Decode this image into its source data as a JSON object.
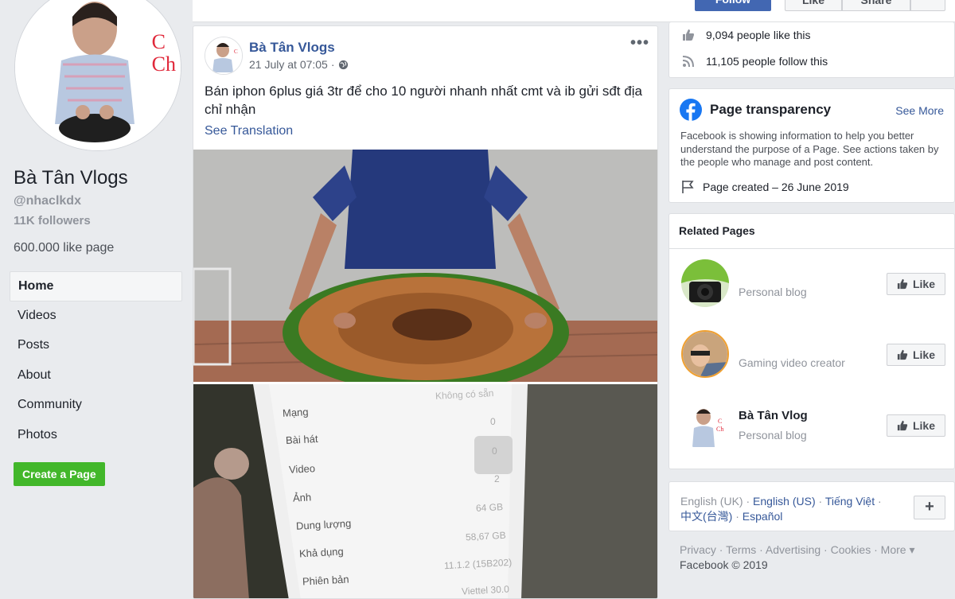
{
  "profile": {
    "name": "Bà Tân Vlogs",
    "handle": "@nhaclkdx",
    "followers": "11K followers",
    "like_page": "600.000 like page",
    "logo_text": "C\nCh"
  },
  "nav": {
    "items": [
      "Home",
      "Videos",
      "Posts",
      "About",
      "Community",
      "Photos"
    ],
    "create_page": "Create a Page"
  },
  "topbar": {
    "follow": "Follow",
    "like": "Like",
    "share": "Share"
  },
  "post": {
    "author": "Bà Tân Vlogs",
    "time": "21 July at 07:05",
    "separator": "·",
    "text": "Bán iphon 6plus giá 3tr để cho 10 người nhanh nhất cmt và ib gửi sđt địa chỉ nhận",
    "see_translation": "See Translation",
    "more": "•••",
    "phone_screen": {
      "status": "Không có sẵn",
      "rows": [
        {
          "label": "Mạng",
          "value": "0"
        },
        {
          "label": "Bài hát",
          "value": "0"
        },
        {
          "label": "Video",
          "value": "2"
        },
        {
          "label": "Ảnh",
          "value": "64 GB"
        },
        {
          "label": "Dung lượng",
          "value": "58,67 GB"
        },
        {
          "label": "Khả dụng",
          "value": "11.1.2 (15B202)"
        },
        {
          "label": "Phiên bản",
          "value": "Viettel 30.0"
        }
      ]
    }
  },
  "stats": {
    "likes": "9,094 people like this",
    "follows": "11,105 people follow this"
  },
  "transparency": {
    "title": "Page transparency",
    "see_more": "See More",
    "description": "Facebook is showing information to help you better understand the purpose of a Page. See actions taken by the people who manage and post content.",
    "created": "Page created – 26 June 2019"
  },
  "related": {
    "title": "Related Pages",
    "like_label": "Like",
    "items": [
      {
        "name": "",
        "subtitle": "Personal blog"
      },
      {
        "name": "",
        "subtitle": "Gaming video creator"
      },
      {
        "name": "Bà Tân Vlog",
        "subtitle": "Personal blog"
      }
    ]
  },
  "languages": {
    "current": "English (UK)",
    "links": [
      "English (US)",
      "Tiếng Việt",
      "中文(台灣)",
      "Español"
    ],
    "more": "+"
  },
  "footer": {
    "links": [
      "Privacy",
      "Terms",
      "Advertising",
      "Cookies",
      "More"
    ],
    "copyright": "Facebook © 2019"
  },
  "colors": {
    "fb_blue": "#4267b2",
    "link": "#365899",
    "green": "#42b72a",
    "bg": "#e9ebee"
  }
}
